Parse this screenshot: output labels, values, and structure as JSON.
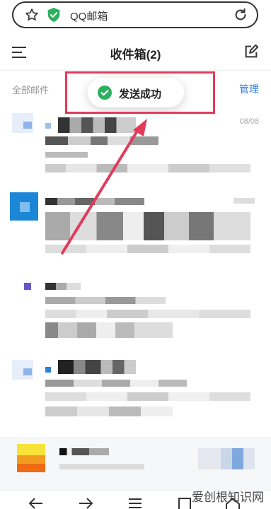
{
  "browser": {
    "address_text": "QQ邮箱"
  },
  "header": {
    "title": "收件箱(2)"
  },
  "filter": {
    "label": "全部邮件",
    "manage_label": "管理"
  },
  "toast": {
    "text": "发送成功"
  },
  "mail_list": [
    {
      "date": "08/08"
    }
  ],
  "watermark": {
    "text": "爱创根知识网"
  },
  "colors": {
    "accent": "#2f7fd8",
    "success": "#2bb05e",
    "annotation": "#e23b5b"
  }
}
